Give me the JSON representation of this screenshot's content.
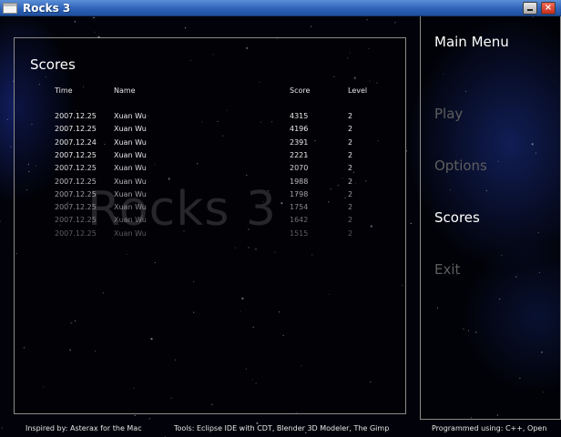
{
  "window": {
    "title": "Rocks 3",
    "minimize_label": "",
    "close_label": "×"
  },
  "watermark": "Rocks 3",
  "scores": {
    "title": "Scores",
    "columns": {
      "time": "Time",
      "name": "Name",
      "score": "Score",
      "level": "Level"
    },
    "rows": [
      {
        "time": "2007.12.25",
        "name": "Xuan Wu",
        "score": "4315",
        "level": "2"
      },
      {
        "time": "2007.12.25",
        "name": "Xuan Wu",
        "score": "4196",
        "level": "2"
      },
      {
        "time": "2007.12.24",
        "name": "Xuan Wu",
        "score": "2391",
        "level": "2"
      },
      {
        "time": "2007.12.25",
        "name": "Xuan Wu",
        "score": "2221",
        "level": "2"
      },
      {
        "time": "2007.12.25",
        "name": "Xuan Wu",
        "score": "2070",
        "level": "2"
      },
      {
        "time": "2007.12.25",
        "name": "Xuan Wu",
        "score": "1988",
        "level": "2"
      },
      {
        "time": "2007.12.25",
        "name": "Xuan Wu",
        "score": "1798",
        "level": "2"
      },
      {
        "time": "2007.12.25",
        "name": "Xuan Wu",
        "score": "1754",
        "level": "2"
      },
      {
        "time": "2007.12.25",
        "name": "Xuan Wu",
        "score": "1642",
        "level": "2"
      },
      {
        "time": "2007.12.25",
        "name": "Xuan Wu",
        "score": "1515",
        "level": "2"
      }
    ]
  },
  "menu": {
    "title": "Main Menu",
    "items": [
      {
        "label": "Play",
        "active": false
      },
      {
        "label": "Options",
        "active": false
      },
      {
        "label": "Scores",
        "active": true
      },
      {
        "label": "Exit",
        "active": false
      }
    ]
  },
  "footer": {
    "inspired": "Inspired by: Asterax for the Mac",
    "tools": "Tools: Eclipse IDE with CDT, Blender 3D Modeler, The Gimp",
    "programmed": "Programmed using: C++, Open"
  },
  "colors": {
    "active_menu": "#ffffff",
    "inactive_menu": "#5e5e5e",
    "panel_border": "#8a8a8a"
  }
}
